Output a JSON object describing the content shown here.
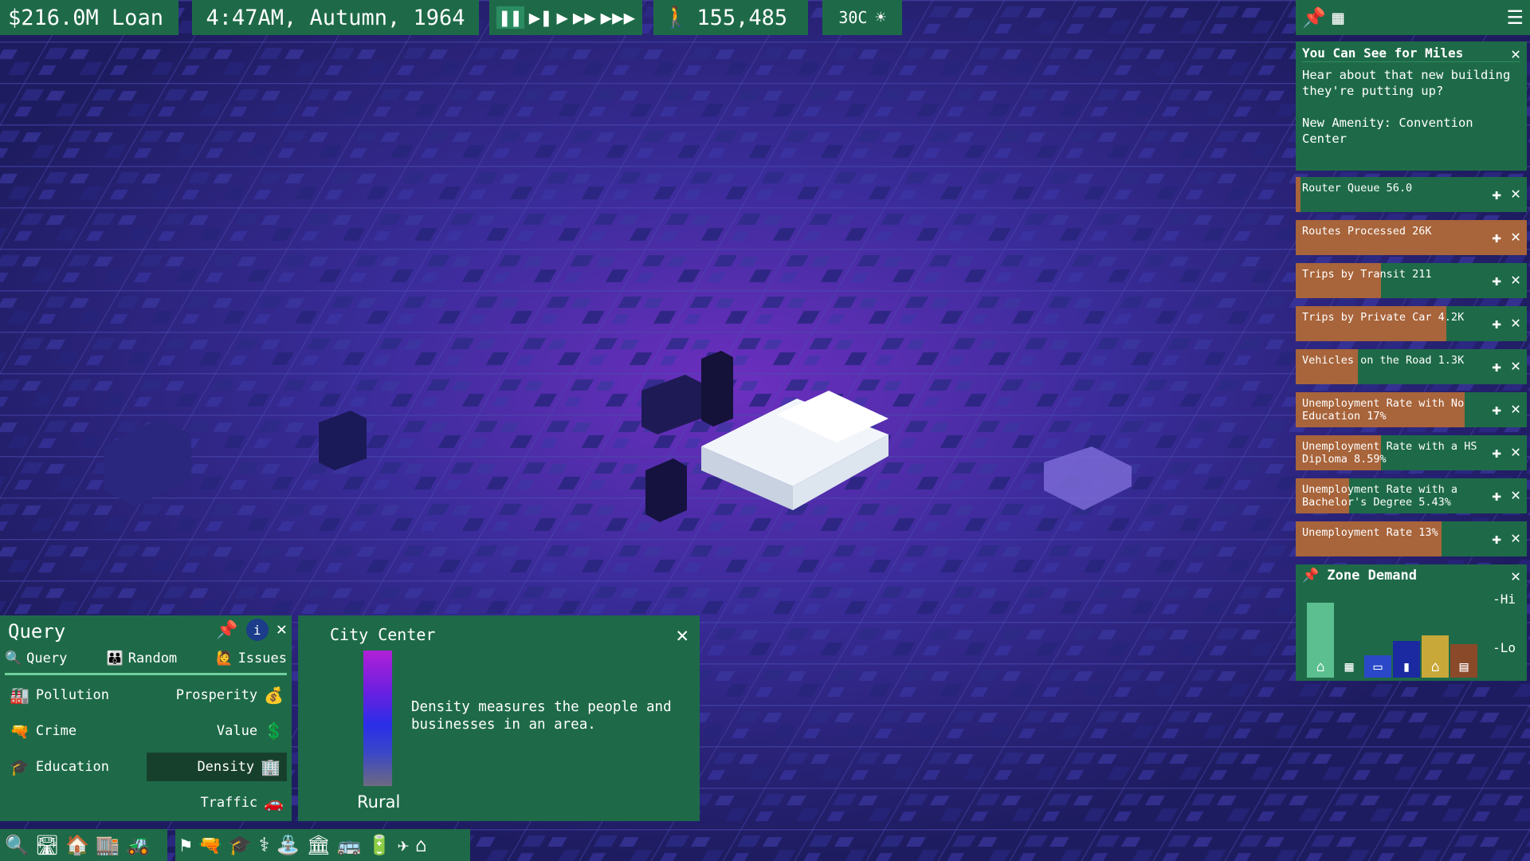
{
  "top_bar": {
    "loan": "$216.0M Loan",
    "clock": "4:47AM, Autumn, 1964",
    "population": "155,485",
    "temperature": "30C"
  },
  "speed_controls": [
    {
      "name": "pause-button",
      "glyph": "❚❚",
      "active": true
    },
    {
      "name": "step-button",
      "glyph": "▶❚"
    },
    {
      "name": "play-button",
      "glyph": "▶"
    },
    {
      "name": "fast-button",
      "glyph": "▶▶"
    },
    {
      "name": "fastest-button",
      "glyph": "▶▶▶"
    }
  ],
  "top_right_tools": [
    "pin-M-icon",
    "grid-B-icon",
    "menu-icon"
  ],
  "news": {
    "title": "You Can See for Miles",
    "body": "Hear about that new building they're putting up?\n\nNew Amenity: Convention Center"
  },
  "stats": [
    {
      "label": "Router Queue 56.0",
      "fill": 0.02
    },
    {
      "label": "Routes Processed 26K",
      "fill": 1.0
    },
    {
      "label": "Trips by Transit 211",
      "fill": 0.37
    },
    {
      "label": "Trips by Private Car 4.2K",
      "fill": 0.65
    },
    {
      "label": "Vehicles on the Road 1.3K",
      "fill": 0.27
    },
    {
      "label": "Unemployment Rate with No Education 17%",
      "fill": 0.73
    },
    {
      "label": "Unemployment Rate with a HS Diploma 8.59%",
      "fill": 0.37
    },
    {
      "label": "Unemployment Rate with a Bachelor's Degree 5.43%",
      "fill": 0.23
    },
    {
      "label": "Unemployment Rate 13%",
      "fill": 0.63
    }
  ],
  "zone_demand": {
    "title": "Zone Demand",
    "hi": "-Hi",
    "lo": "-Lo",
    "bars": [
      {
        "name": "residential-demand",
        "icon": "house",
        "color": "#5bbf8f",
        "level": 0.85
      },
      {
        "name": "apartment-demand",
        "icon": "building",
        "color": "#1e6a48",
        "level": 0.25
      },
      {
        "name": "retail-demand",
        "icon": "shop",
        "color": "#2a48c8",
        "level": 0.25
      },
      {
        "name": "office-demand",
        "icon": "office",
        "color": "#1b2aa0",
        "level": 0.42
      },
      {
        "name": "farm-demand",
        "icon": "barn",
        "color": "#c9a83a",
        "level": 0.48
      },
      {
        "name": "industrial-demand",
        "icon": "factory",
        "color": "#8a4a2a",
        "level": 0.38
      }
    ]
  },
  "query_panel": {
    "title": "Query",
    "modes": [
      "Query",
      "Random",
      "Issues"
    ],
    "mode_keys": [
      "Q",
      "F",
      "Z"
    ],
    "left_items": [
      {
        "label": "Pollution",
        "key": "Y"
      },
      {
        "label": "Crime",
        "key": "C"
      },
      {
        "label": "Education",
        "key": "E"
      }
    ],
    "right_items": [
      {
        "label": "Prosperity",
        "key": "R"
      },
      {
        "label": "Value",
        "key": "V"
      },
      {
        "label": "Density",
        "key": "G",
        "selected": true
      },
      {
        "label": "Traffic",
        "key": "T"
      }
    ]
  },
  "legend_panel": {
    "title": "City Center",
    "bottom_label": "Rural",
    "description": "Density measures the people and businesses in an area."
  }
}
